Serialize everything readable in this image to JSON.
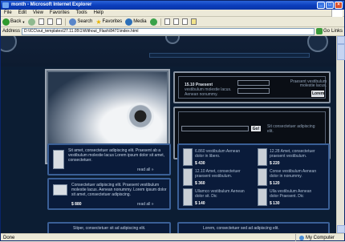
{
  "window": {
    "title": "month - Microsoft Internet Explorer"
  },
  "menu": [
    "File",
    "Edit",
    "View",
    "Favorites",
    "Tools",
    "Help"
  ],
  "toolbar": {
    "back_label": "Back",
    "search_label": "Search",
    "favorites_label": "Favorites",
    "media_label": "Media"
  },
  "address": {
    "label": "Address",
    "url": "D:\\ICC\\out_templates\\27.11.05\\1\\Without_Flash\\8471\\index.html",
    "go_label": "Go",
    "links_label": "Links"
  },
  "status": {
    "left": "Done",
    "zone": "My Computer"
  },
  "site": {
    "login": {
      "text_bold": "15.10 Praesent",
      "text_rest": "vestibulum molestie lacus. Aenean nonummy.",
      "right_text": "Praesent vestibulum molestie lacus.",
      "button": "Lorem"
    },
    "search": {
      "button": "Go!",
      "text": "Sit consectetuer adipiscing elit."
    },
    "cards": [
      {
        "text": "Sit amet, consectetuer adipiscing elit. Praesent ab a vestibulum molestie lacus Lorem ipsum dolor sit amet, consectetuer.",
        "more": "read all"
      },
      {
        "text": "Consectetuer adipiscing elit. Praesent vestibulum molestie lacus. Aenean nonummy. Lorem ipsum dolor sit amet, consectetuer adipiscing.",
        "price": "$ 880",
        "more": "read all"
      }
    ],
    "products": [
      {
        "desc": "6.860 vestibulum Aenean dolor in libero.",
        "price": "$ 430"
      },
      {
        "desc": "12.28 Amet, consectetuer praesent vestibulum.",
        "price": "$ 220"
      },
      {
        "desc": "12.10 Amet, consectetuer praesent vestibulum.",
        "price": "$ 360"
      },
      {
        "desc": "Conse vestibulum Aenean dolor in nonummy.",
        "price": "$ 120"
      },
      {
        "desc": "Ullamco vestibulum Aenean dolor sit. Dic",
        "price": "$ 140"
      },
      {
        "desc": "Ulla vestibulum Aenean dolor Praesent. Dic",
        "price": "$ 130"
      }
    ],
    "bottom": [
      {
        "text": "Stiper, consectetuer sit ad adipiscing elit."
      },
      {
        "text": "Lorem, consectetuer sed ad adipiscing elit."
      }
    ]
  }
}
